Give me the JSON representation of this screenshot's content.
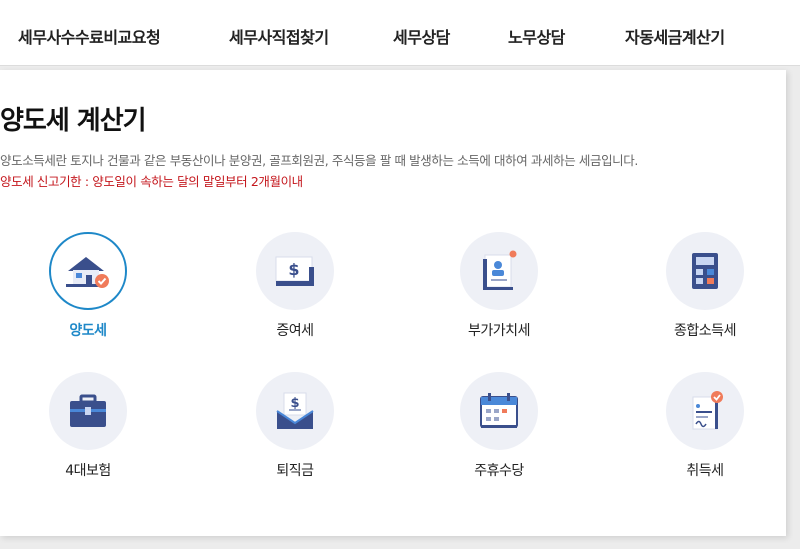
{
  "nav": {
    "items": [
      {
        "label": "세무사수수료비교요청"
      },
      {
        "label": "세무사직접찾기"
      },
      {
        "label": "세무상담"
      },
      {
        "label": "노무상담"
      },
      {
        "label": "자동세금계산기"
      }
    ]
  },
  "page": {
    "title": "양도세 계산기",
    "description": "양도소득세란 토지나 건물과 같은 부동산이나 분양권, 골프회원권, 주식등을 팔 때 발생하는 소득에 대하여 과세하는 세금입니다.",
    "deadline": "양도세 신고기한 : 양도일이 속하는 달의 말일부터 2개월이내"
  },
  "calculators": [
    {
      "label": "양도세",
      "icon": "house-transfer-icon",
      "active": true
    },
    {
      "label": "증여세",
      "icon": "money-envelope-icon",
      "active": false
    },
    {
      "label": "부가가치세",
      "icon": "document-person-icon",
      "active": false
    },
    {
      "label": "종합소득세",
      "icon": "calculator-icon",
      "active": false
    },
    {
      "label": "4대보험",
      "icon": "briefcase-icon",
      "active": false
    },
    {
      "label": "퇴직금",
      "icon": "pay-envelope-icon",
      "active": false
    },
    {
      "label": "주휴수당",
      "icon": "calendar-icon",
      "active": false
    },
    {
      "label": "취득세",
      "icon": "contract-check-icon",
      "active": false
    }
  ],
  "colors": {
    "accent": "#1e88c8",
    "deadline": "#c4161c",
    "icon_navy": "#3a4f8c",
    "icon_blue": "#4a88d8",
    "icon_orange": "#f07b5a",
    "circle_bg": "#eef0f6"
  }
}
